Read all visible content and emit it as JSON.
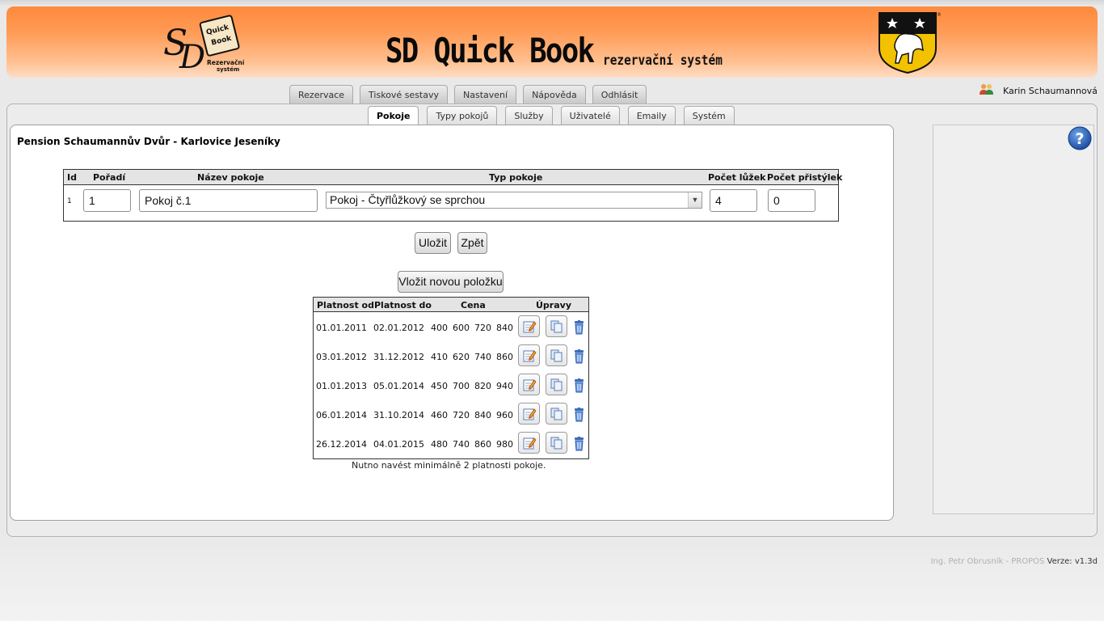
{
  "header": {
    "logo_text": [
      "Quick",
      "Book",
      "Rezervační",
      "systém"
    ],
    "title": "SD Quick Book",
    "subtitle": "rezervační systém"
  },
  "topnav": [
    {
      "label": "Rezervace"
    },
    {
      "label": "Tiskové sestavy"
    },
    {
      "label": "Nastavení"
    },
    {
      "label": "Nápověda"
    },
    {
      "label": "Odhlásit"
    }
  ],
  "user": {
    "name": "Karin Schaumannová"
  },
  "subnav": [
    {
      "label": "Pokoje",
      "active": true
    },
    {
      "label": "Typy pokojů"
    },
    {
      "label": "Služby"
    },
    {
      "label": "Uživatelé"
    },
    {
      "label": "Emaily"
    },
    {
      "label": "Systém"
    }
  ],
  "page": {
    "title": "Pension Schaumannův Dvůr - Karlovice Jeseníky"
  },
  "room_table": {
    "headers": {
      "id": "Id",
      "order": "Pořadí",
      "name": "Název pokoje",
      "type": "Typ pokoje",
      "beds": "Počet lůžek",
      "extra_beds": "Počet přistýlek"
    },
    "row": {
      "id": "1",
      "order": "1",
      "name": "Pokoj č.1",
      "type": "Pokoj - Čtyřlůžkový se sprchou",
      "beds": "4",
      "extra_beds": "0"
    }
  },
  "buttons": {
    "save": "Uložit",
    "back": "Zpět",
    "add_item": "Vložit novou položku"
  },
  "price_table": {
    "headers": {
      "valid_from": "Platnost od",
      "valid_to": "Platnost do",
      "price": "Cena",
      "edits": "Úpravy"
    },
    "rows": [
      {
        "from": "01.01.2011",
        "to": "02.01.2012",
        "prices": [
          "400",
          "600",
          "720",
          "840"
        ]
      },
      {
        "from": "03.01.2012",
        "to": "31.12.2012",
        "prices": [
          "410",
          "620",
          "740",
          "860"
        ]
      },
      {
        "from": "01.01.2013",
        "to": "05.01.2014",
        "prices": [
          "450",
          "700",
          "820",
          "940"
        ]
      },
      {
        "from": "06.01.2014",
        "to": "31.10.2014",
        "prices": [
          "460",
          "720",
          "840",
          "960"
        ]
      },
      {
        "from": "26.12.2014",
        "to": "04.01.2015",
        "prices": [
          "480",
          "740",
          "860",
          "980"
        ]
      }
    ],
    "row_actions": [
      "edit-icon",
      "copy-icon",
      "trash-icon"
    ],
    "note": "Nutno navést minimálně 2 platnosti pokoje."
  },
  "footer": {
    "author": "Ing. Petr Obrusník - PROPOS",
    "version": "Verze: v1.3d"
  },
  "colors": {
    "banner_top": "#ff8a3c",
    "banner_bottom": "#ffdcc4",
    "panel_bg": "#ececec",
    "help_blue": "#2a62b8"
  }
}
